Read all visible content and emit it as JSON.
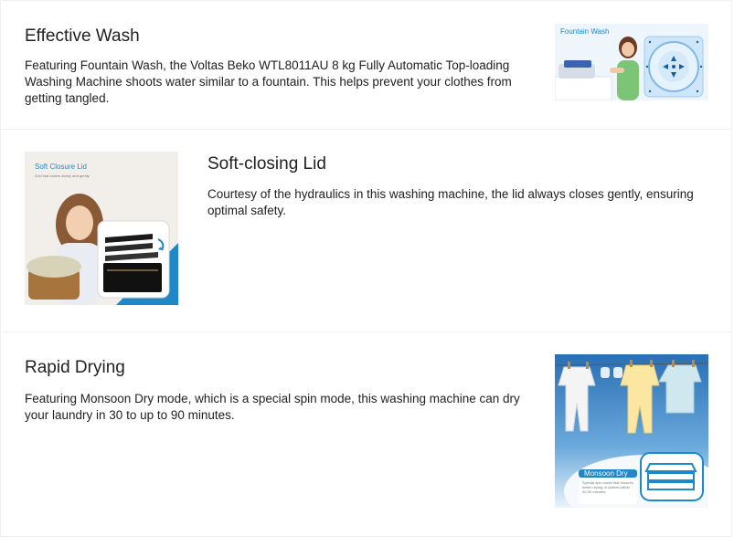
{
  "sections": [
    {
      "title": "Effective Wash",
      "description": "Featuring Fountain Wash, the Voltas Beko WTL8011AU 8 kg Fully Automatic Top-loading Washing Machine shoots water similar to a fountain. This helps prevent your clothes from getting tangled.",
      "image": {
        "title": "Fountain Wash"
      }
    },
    {
      "title": "Soft-closing Lid",
      "description": "Courtesy of the hydraulics in this washing machine, the lid always closes gently, ensuring optimal safety.",
      "image": {
        "title": "Soft Closure Lid",
        "subtitle": "A lid that lowers slowly and gently"
      }
    },
    {
      "title": "Rapid Drying",
      "description": "Featuring Monsoon Dry mode, which is a special spin mode, this washing machine can dry your laundry in 30 to up to 90 minutes.",
      "image": {
        "title": "Monsoon Dry",
        "subtitle": "Special spin mode that ensures better drying of clothes within 30-90 minutes."
      }
    }
  ],
  "colors": {
    "accent": "#1e88c8",
    "text": "#212121",
    "divider": "#f0f0f0"
  }
}
